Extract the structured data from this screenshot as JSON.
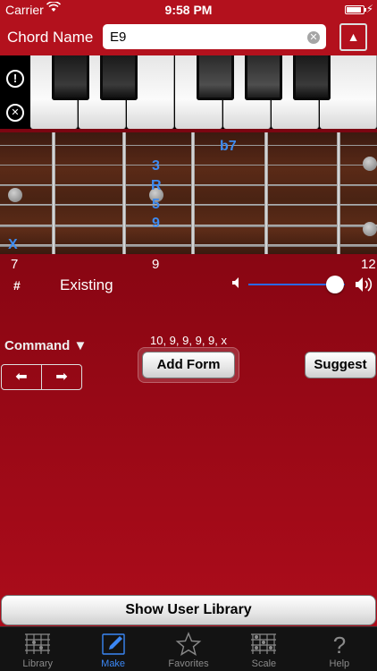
{
  "status_bar": {
    "carrier": "Carrier",
    "time": "9:58 PM",
    "battery_level": 0.9
  },
  "header": {
    "chord_label": "Chord Name",
    "chord_value": "E9",
    "clear_glyph": "✕",
    "up_glyph": "▲"
  },
  "side_icons": {
    "alert_glyph": "!",
    "close_glyph": "✕"
  },
  "fretboard": {
    "notes": [
      "b7",
      "3",
      "R",
      "5",
      "9"
    ],
    "mute": "X",
    "fret_numbers": [
      "7",
      "9",
      "12"
    ]
  },
  "controls": {
    "sharp": "#",
    "existing": "Existing",
    "volume_level": 0.9,
    "command": "Command ▼",
    "left_arrow": "⬅",
    "right_arrow": "➡",
    "chord_form": "10, 9, 9, 9, 9, x",
    "add_form": "Add Form",
    "suggest": "Suggest",
    "show_user_library": "Show User Library"
  },
  "tab_bar": {
    "items": [
      {
        "label": "Library",
        "icon": "library-icon"
      },
      {
        "label": "Make",
        "icon": "pencil-icon"
      },
      {
        "label": "Favorites",
        "icon": "star-icon"
      },
      {
        "label": "Scale",
        "icon": "scale-icon"
      },
      {
        "label": "Help",
        "icon": "help-icon"
      }
    ],
    "active": "Make"
  },
  "colors": {
    "accent": "#3b87f5",
    "header_red": "#b3111d",
    "note_blue": "#3e8bf0"
  }
}
